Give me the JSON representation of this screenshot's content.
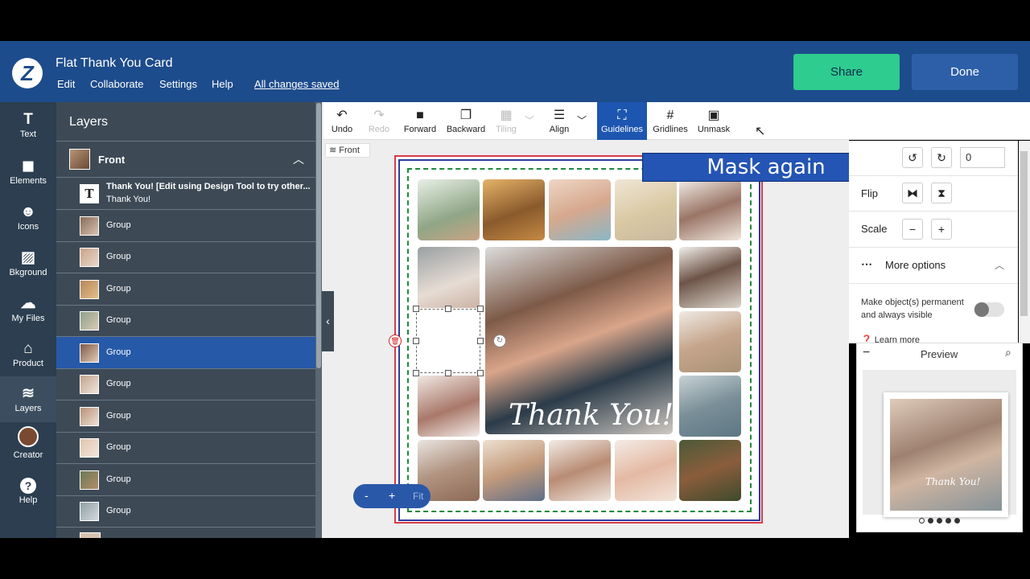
{
  "app": {
    "logo": "Z",
    "title": "Flat Thank You Card",
    "menu": [
      "Edit",
      "Collaborate",
      "Settings",
      "Help"
    ],
    "save_status": "All changes saved",
    "share_label": "Share",
    "done_label": "Done"
  },
  "rail": [
    {
      "label": "Text",
      "icon": "text-icon"
    },
    {
      "label": "Elements",
      "icon": "elements-icon"
    },
    {
      "label": "Icons",
      "icon": "emoji-icon"
    },
    {
      "label": "Bkground",
      "icon": "background-icon"
    },
    {
      "label": "My Files",
      "icon": "cloud-icon"
    },
    {
      "label": "Product",
      "icon": "product-icon"
    },
    {
      "label": "Layers",
      "icon": "layers-icon"
    },
    {
      "label": "Creator",
      "icon": "avatar-icon"
    },
    {
      "label": "Help",
      "icon": "help-icon"
    }
  ],
  "layers": {
    "title": "Layers",
    "page": "Front",
    "text_layer_title": "Thank You! [Edit using Design Tool to try other...",
    "text_layer_sub": "Thank You!",
    "group_label": "Group",
    "selected_index": 4
  },
  "toolbar": {
    "undo": "Undo",
    "redo": "Redo",
    "forward": "Forward",
    "backward": "Backward",
    "tiling": "Tiling",
    "align": "Align",
    "guidelines": "Guidelines",
    "gridlines": "Gridlines",
    "unmask": "Unmask"
  },
  "canvas": {
    "page_tab": "Front",
    "hero_text": "Thank You!",
    "zoom_minus": "-",
    "zoom_plus": "+",
    "zoom_fit": "Fit"
  },
  "banner": "Mask again",
  "props": {
    "rotate_value": "0",
    "flip_label": "Flip",
    "scale_label": "Scale",
    "more_options": "More options",
    "permanent_label": "Make object(s) permanent and always visible",
    "learn_more": "Learn more",
    "preview_title": "Preview",
    "preview_text": "Thank You!"
  },
  "colors": {
    "header": "#1d4c8c",
    "share": "#2ecc8f",
    "done": "#2d5fa8",
    "selected_layer": "#2659a8",
    "banner": "#2454b4"
  }
}
